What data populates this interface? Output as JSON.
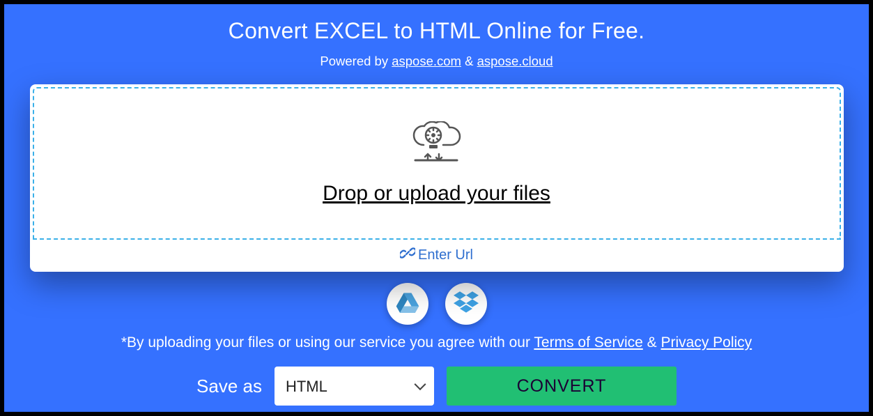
{
  "header": {
    "title": "Convert EXCEL to HTML Online for Free.",
    "powered_prefix": "Powered by ",
    "powered_link1": "aspose.com",
    "powered_amp": " & ",
    "powered_link2": "aspose.cloud"
  },
  "upload": {
    "drop_text": "Drop or upload your files",
    "enter_url": "Enter Url"
  },
  "cloud": {
    "gdrive": "google-drive",
    "dropbox": "dropbox"
  },
  "terms": {
    "prefix": "*By uploading your files or using our service you agree with our ",
    "tos": "Terms of Service",
    "amp": " & ",
    "privacy": "Privacy Policy"
  },
  "action": {
    "save_as_label": "Save as",
    "selected_format": "HTML",
    "convert_label": "CONVERT"
  },
  "colors": {
    "primary": "#3571ff",
    "accent": "#21bf73",
    "dash": "#3ab0e8",
    "link_blue": "#2f6fcf"
  }
}
